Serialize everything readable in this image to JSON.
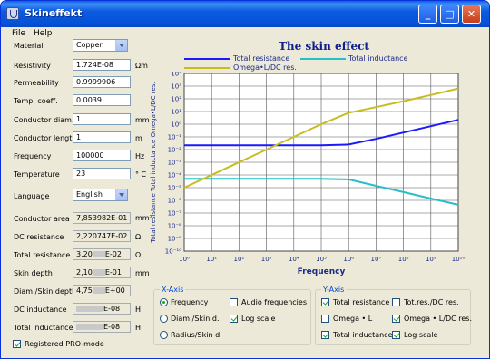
{
  "window": {
    "title": "Skineffekt"
  },
  "menu": [
    "File",
    "Help"
  ],
  "form": {
    "material": {
      "label": "Material",
      "value": "Copper"
    },
    "resistivity": {
      "label": "Resistivity",
      "value": "1.724E-08",
      "unit": "Ωm"
    },
    "permeability": {
      "label": "Permeability",
      "value": "0.9999906"
    },
    "temp_coeff": {
      "label": "Temp. coeff.",
      "value": "0.0039"
    },
    "conductor_diam": {
      "label": "Conductor diam.",
      "value": "1",
      "unit": "mm"
    },
    "conductor_length": {
      "label": "Conductor length",
      "value": "1",
      "unit": "m"
    },
    "frequency": {
      "label": "Frequency",
      "value": "100000",
      "unit": "Hz"
    },
    "temperature": {
      "label": "Temperature",
      "value": "23",
      "unit": "° C"
    },
    "language": {
      "label": "Language",
      "value": "English"
    },
    "conductor_area": {
      "label": "Conductor area",
      "value": "7,853982E-01",
      "unit": "mm²"
    },
    "dc_resistance": {
      "label": "DC resistance",
      "value": "2,220747E-02",
      "unit": "Ω"
    },
    "total_resistance": {
      "label": "Total resistance",
      "prefix": "3,20",
      "suffix": "E-02",
      "unit": "Ω"
    },
    "skin_depth": {
      "label": "Skin depth",
      "prefix": "2,10",
      "suffix": "E-01",
      "unit": "mm"
    },
    "diam_skin": {
      "label": "Diam./Skin depth",
      "prefix": "4,75",
      "suffix": "E+00"
    },
    "dc_inductance": {
      "label": "DC inductance",
      "prefix": "",
      "suffix": "E-08",
      "unit": "H"
    },
    "total_inductance": {
      "label": "Total inductance",
      "prefix": "",
      "suffix": "E-08",
      "unit": "H"
    },
    "pro_mode": {
      "label": "Registered PRO-mode",
      "checked": true
    }
  },
  "xaxis_group": {
    "title": "X-Axis",
    "radio_frequency": "Frequency",
    "radio_diam": "Diam./Skin d.",
    "radio_radius": "Radius/Skin d.",
    "chk_audio": "Audio frequencies",
    "chk_log": "Log scale"
  },
  "yaxis_group": {
    "title": "Y-Axis",
    "chk_total_res": "Total resistance",
    "chk_omega_l": "Omega • L",
    "chk_total_ind": "Total inductance",
    "chk_tot_dc": "Tot.res./DC res.",
    "chk_omega_ldc": "Omega • L/DC res.",
    "chk_log": "Log scale"
  },
  "chart_data": {
    "type": "line",
    "title": "The skin effect",
    "xlabel": "Frequency",
    "ylabel": "Total resistance  Total inductance  Omega•L/DC res.",
    "xscale": "log",
    "yscale": "log",
    "xlim": [
      1,
      10000000000
    ],
    "ylim": [
      1e-10,
      10000
    ],
    "x_ticks": [
      "10⁰",
      "10¹",
      "10²",
      "10³",
      "10⁴",
      "10⁵",
      "10⁶",
      "10⁷",
      "10⁸",
      "10⁹",
      "10¹⁰"
    ],
    "y_ticks": [
      "10⁴",
      "10³",
      "10²",
      "10¹",
      "10⁰",
      "10⁻¹",
      "10⁻²",
      "10⁻³",
      "10⁻⁴",
      "10⁻⁵",
      "10⁻⁶",
      "10⁻⁷",
      "10⁻⁸",
      "10⁻⁹",
      "10⁻¹⁰"
    ],
    "legend_position": "top",
    "series": [
      {
        "name": "Total resistance",
        "color": "#1a1aff",
        "points": [
          [
            1,
            0.022
          ],
          [
            10,
            0.022
          ],
          [
            100,
            0.022
          ],
          [
            1000,
            0.022
          ],
          [
            10000,
            0.022
          ],
          [
            100000,
            0.022
          ],
          [
            1000000,
            0.025
          ],
          [
            10000000,
            0.07
          ],
          [
            100000000,
            0.22
          ],
          [
            1000000000,
            0.7
          ],
          [
            10000000000,
            2.2
          ]
        ]
      },
      {
        "name": "Total inductance",
        "color": "#26bfc6",
        "points": [
          [
            1,
            5e-05
          ],
          [
            10,
            5e-05
          ],
          [
            100,
            5e-05
          ],
          [
            1000,
            5e-05
          ],
          [
            10000,
            5e-05
          ],
          [
            100000,
            5e-05
          ],
          [
            1000000,
            4.5e-05
          ],
          [
            10000000,
            1.4e-05
          ],
          [
            100000000,
            4.5e-06
          ],
          [
            1000000000,
            1.4e-06
          ],
          [
            10000000000,
            4.5e-07
          ]
        ]
      },
      {
        "name": "Omega•L/DC res.",
        "color": "#c8bd1e",
        "points": [
          [
            1,
            1e-05
          ],
          [
            10,
            0.0001
          ],
          [
            100,
            0.001
          ],
          [
            1000,
            0.01
          ],
          [
            10000,
            0.1
          ],
          [
            100000,
            1
          ],
          [
            1000000,
            8
          ],
          [
            10000000,
            22
          ],
          [
            100000000,
            65
          ],
          [
            1000000000,
            200
          ],
          [
            10000000000,
            650
          ]
        ]
      }
    ]
  }
}
